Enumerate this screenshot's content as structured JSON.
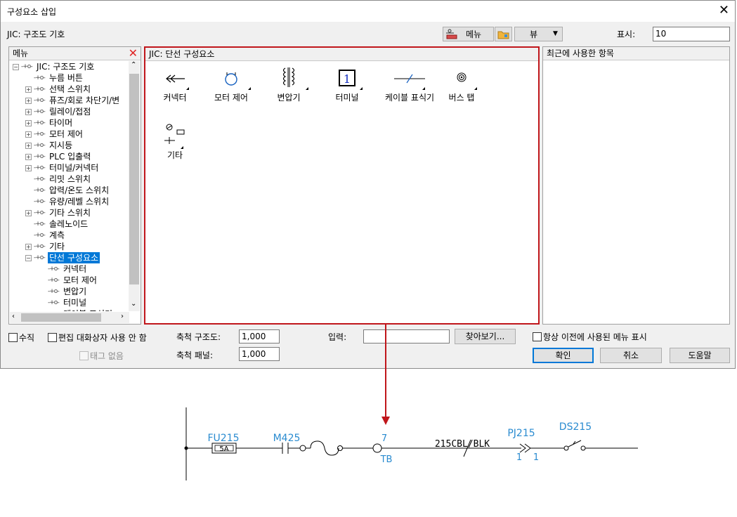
{
  "window": {
    "title": "구성요소 삽입",
    "close_glyph": "✕"
  },
  "header": {
    "library": "JIC: 구조도 기호",
    "menu_button": "메뉴",
    "view_button": "뷰",
    "display_label": "표시:",
    "display_value": "10"
  },
  "menu_panel": {
    "title": "메뉴",
    "tree": [
      {
        "label": "JIC: 구조도 기호",
        "expander": "−",
        "level": 0
      },
      {
        "label": "누름 버튼",
        "expander": "",
        "level": 1
      },
      {
        "label": "선택 스위치",
        "expander": "+",
        "level": 1
      },
      {
        "label": "퓨즈/회로 차단기/변",
        "expander": "+",
        "level": 1
      },
      {
        "label": "릴레이/접점",
        "expander": "+",
        "level": 1
      },
      {
        "label": "타이머",
        "expander": "+",
        "level": 1
      },
      {
        "label": "모터 제어",
        "expander": "+",
        "level": 1
      },
      {
        "label": "지시등",
        "expander": "+",
        "level": 1
      },
      {
        "label": "PLC 입출력",
        "expander": "+",
        "level": 1
      },
      {
        "label": "터미널/커넥터",
        "expander": "+",
        "level": 1
      },
      {
        "label": "리밋 스위치",
        "expander": "",
        "level": 1
      },
      {
        "label": "압력/온도 스위치",
        "expander": "",
        "level": 1
      },
      {
        "label": "유량/레벨 스위치",
        "expander": "",
        "level": 1
      },
      {
        "label": "기타 스위치",
        "expander": "+",
        "level": 1
      },
      {
        "label": "솔레노이드",
        "expander": "",
        "level": 1
      },
      {
        "label": "계측",
        "expander": "",
        "level": 1
      },
      {
        "label": "기타",
        "expander": "+",
        "level": 1
      },
      {
        "label": "단선 구성요소",
        "expander": "−",
        "level": 1,
        "selected": true
      },
      {
        "label": "커넥터",
        "expander": "",
        "level": 2
      },
      {
        "label": "모터 제어",
        "expander": "",
        "level": 2
      },
      {
        "label": "변압기",
        "expander": "",
        "level": 2
      },
      {
        "label": "터미널",
        "expander": "",
        "level": 2
      },
      {
        "label": "케이블 표식기",
        "expander": "",
        "level": 2
      }
    ]
  },
  "center_panel": {
    "title": "JIC: 단선 구성요소",
    "icons": [
      {
        "label": "커넥터",
        "icon": "connector-icon"
      },
      {
        "label": "모터 제어",
        "icon": "motor-control-icon"
      },
      {
        "label": "변압기",
        "icon": "transformer-icon"
      },
      {
        "label": "터미널",
        "icon": "terminal-icon",
        "glyph": "1"
      },
      {
        "label": "케이블 표식기",
        "icon": "cable-marker-icon"
      },
      {
        "label": "버스 탭",
        "icon": "bus-tap-icon"
      },
      {
        "label": "기타",
        "icon": "misc-icon"
      }
    ]
  },
  "recent_panel": {
    "title": "최근에 사용한 항목"
  },
  "bottom": {
    "vertical_label": "수직",
    "no_edit_dialog_label": "편집 대화상자 사용 안 함",
    "no_tag_label": "태그 없음",
    "scale_schematic_label": "축척 구조도:",
    "scale_schematic_value": "1,000",
    "scale_panel_label": "축척 패널:",
    "scale_panel_value": "1,000",
    "input_label": "입력:",
    "input_value": "",
    "browse_button": "찾아보기...",
    "always_show_prev_label": "항상 이전에 사용된 메뉴 표시",
    "ok_button": "확인",
    "cancel_button": "취소",
    "help_button": "도움말"
  },
  "diagram": {
    "fuse_tag": "FU215",
    "fuse_rating": "5A",
    "motor_tag": "M425",
    "terminal_number": "7",
    "terminal_tag": "TB",
    "cable_label": "215CBL/BLK",
    "connector_tag": "PJ215",
    "connector_pin_left": "1",
    "connector_pin_right": "1",
    "disconnect_tag": "DS215"
  },
  "colors": {
    "highlight_red": "#c0161b",
    "selection_blue": "#0078d7",
    "diagram_blue": "#2a8bd0",
    "close_red": "#e02424"
  }
}
